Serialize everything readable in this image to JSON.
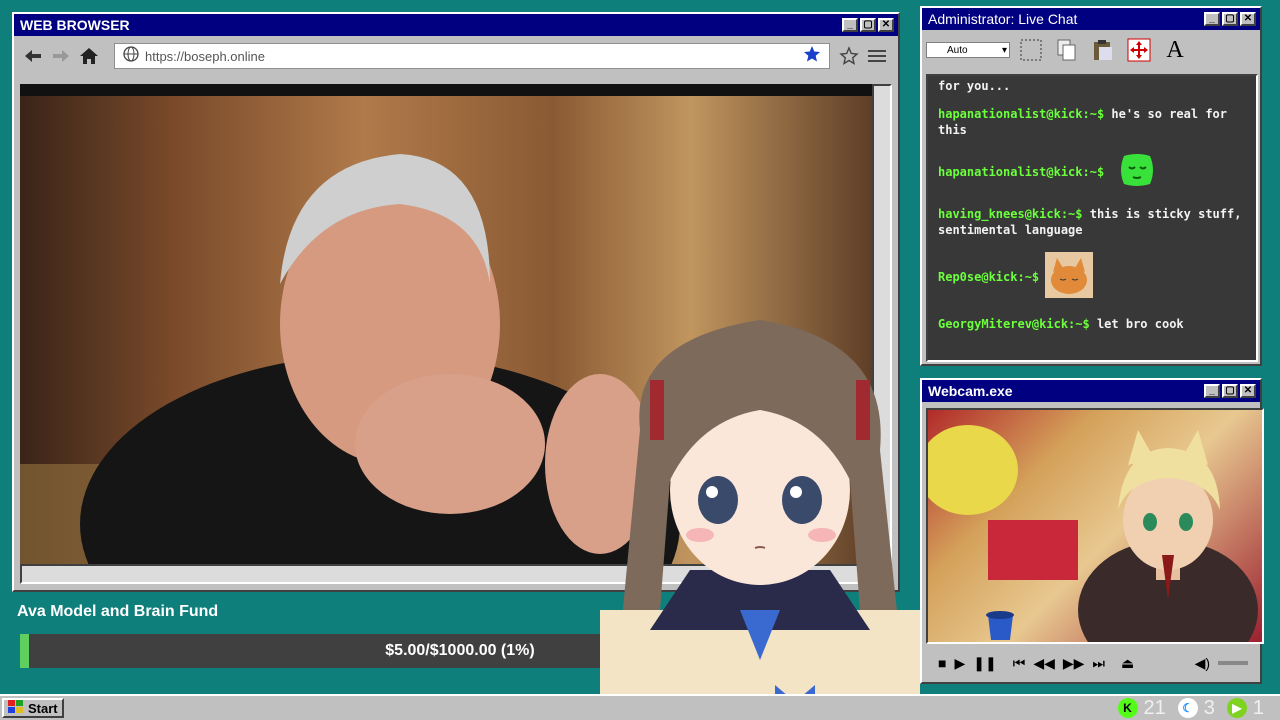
{
  "browser": {
    "title": "WEB BROWSER",
    "url": "https://boseph.online"
  },
  "chat": {
    "title": "Administrator: Live Chat",
    "font_select": "Auto",
    "partial_text": "for you...",
    "messages": [
      {
        "user": "hapanationalist@kick:~$",
        "text": "he's so real for this",
        "emote": ""
      },
      {
        "user": "hapanationalist@kick:~$",
        "text": "",
        "emote": "green-face-emote"
      },
      {
        "user": "having_knees@kick:~$",
        "text": "this is sticky stuff, sentimental language",
        "emote": ""
      },
      {
        "user": "Rep0se@kick:~$",
        "text": "",
        "emote": "cat-emote"
      },
      {
        "user": "GeorgyMiterev@kick:~$",
        "text": "let bro cook",
        "emote": ""
      }
    ]
  },
  "webcam": {
    "title": "Webcam.exe"
  },
  "fund": {
    "title": "Ava Model and Brain Fund",
    "status": "$5.00/$1000.00 (1%)",
    "progress_fraction": 0.01,
    "fill_color": "#5fd05f"
  },
  "taskbar": {
    "start_label": "Start",
    "tray": [
      {
        "icon": "kick-icon",
        "count": "21",
        "color": "#53fc18"
      },
      {
        "icon": "moon-icon",
        "count": "3",
        "color": "#1e90ff"
      },
      {
        "icon": "play-icon",
        "count": "1",
        "color": "#7ed321"
      }
    ]
  },
  "colors": {
    "desktop": "#0f7f7c",
    "titlebar": "#000080",
    "chat_username": "#6cff3c"
  }
}
